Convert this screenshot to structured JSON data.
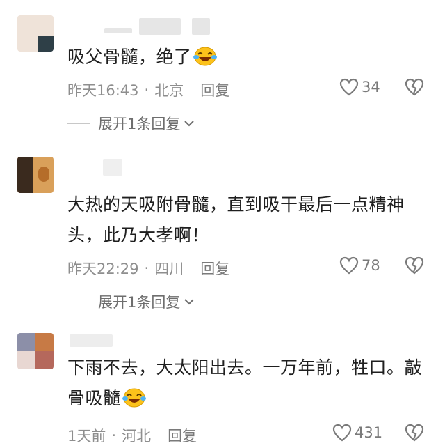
{
  "comments": [
    {
      "text": "吸父骨髓，绝了",
      "time": "昨天16:43",
      "location": "北京",
      "reply_label": "回复",
      "likes": "34",
      "expand_label": "展开1条回复"
    },
    {
      "text": "大热的天吸附骨髓，直到吸干最后一点精神头，此乃大孝啊！",
      "time": "昨天22:29",
      "location": "四川",
      "reply_label": "回复",
      "likes": "78",
      "expand_label": "展开1条回复"
    },
    {
      "text": "下雨不去，大太阳出去。一万年前，牲口。敲骨吸髓",
      "time": "1天前",
      "location": "河北",
      "reply_label": "回复",
      "likes": "431"
    }
  ],
  "icons": {
    "like": "heart-outline-icon",
    "dislike": "broken-heart-icon",
    "expand": "chevron-down-icon",
    "emoji": "laugh-cry-emoji-icon"
  },
  "colors": {
    "text": "#1f1f1f",
    "meta": "#8e8e8e",
    "icon": "#7a7a7a"
  }
}
